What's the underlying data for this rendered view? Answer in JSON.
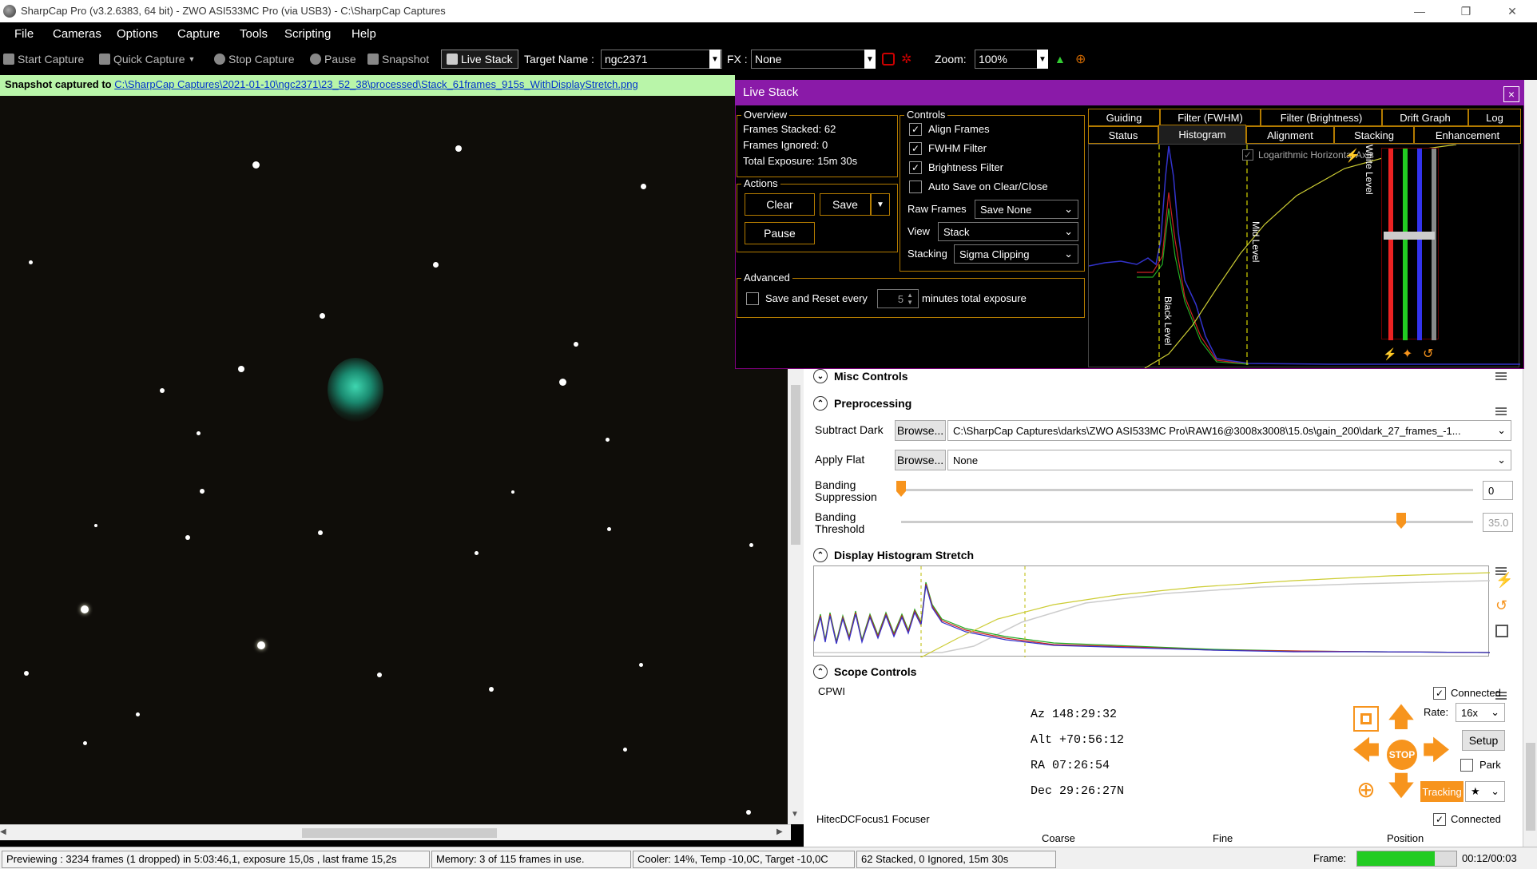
{
  "window": {
    "title": "SharpCap Pro (v3.2.6383, 64 bit) - ZWO ASI533MC Pro (via USB3) - C:\\SharpCap Captures",
    "minimize": "—",
    "maximize": "❐",
    "close": "✕"
  },
  "menu": [
    "File",
    "Cameras",
    "Options",
    "Capture",
    "Tools",
    "Scripting",
    "Help"
  ],
  "toolbar": {
    "start_capture": "Start Capture",
    "quick_capture": "Quick Capture",
    "stop_capture": "Stop Capture",
    "pause": "Pause",
    "snapshot": "Snapshot",
    "live_stack": "Live Stack",
    "target_name_label": "Target Name :",
    "target_name_value": "ngc2371",
    "fx_label": "FX :",
    "fx_value": "None",
    "zoom_label": "Zoom:",
    "zoom_value": "100%"
  },
  "snapshot_bar": {
    "prefix": "Snapshot captured to",
    "path": "C:\\SharpCap Captures\\2021-01-10\\ngc2371\\23_52_38\\processed\\Stack_61frames_915s_WithDisplayStretch.png"
  },
  "live_stack": {
    "title": "Live Stack",
    "close": "×",
    "overview": {
      "title": "Overview",
      "frames_stacked": "Frames Stacked:  62",
      "frames_ignored": "Frames Ignored:   0",
      "total_exposure": "Total Exposure:   15m 30s"
    },
    "actions": {
      "title": "Actions",
      "clear": "Clear",
      "save": "Save",
      "pause": "Pause"
    },
    "advanced": {
      "title": "Advanced",
      "save_reset_label": "Save and Reset every",
      "save_reset_value": "5",
      "save_reset_suffix": "minutes total exposure"
    },
    "controls": {
      "title": "Controls",
      "align_frames": "Align Frames",
      "fwhm_filter": "FWHM Filter",
      "brightness_filter": "Brightness Filter",
      "auto_save": "Auto Save on Clear/Close",
      "raw_frames_label": "Raw Frames",
      "raw_frames_value": "Save None",
      "view_label": "View",
      "view_value": "Stack",
      "stacking_label": "Stacking",
      "stacking_value": "Sigma Clipping"
    },
    "tabs_row1": [
      "Guiding",
      "Filter (FWHM)",
      "Filter (Brightness)",
      "Drift Graph",
      "Log"
    ],
    "tabs_row2": [
      "Status",
      "Histogram",
      "Alignment",
      "Stacking",
      "Enhancement"
    ],
    "histogram": {
      "log_axis": "Logarithmic Horizontal Axis",
      "black_level": "Black Level",
      "mid_level": "Mid Level",
      "white_level": "White Level"
    }
  },
  "panels": {
    "misc_controls": "Misc Controls",
    "preprocessing": {
      "title": "Preprocessing",
      "subtract_dark_label": "Subtract Dark",
      "browse": "Browse...",
      "subtract_dark_value": "C:\\SharpCap Captures\\darks\\ZWO ASI533MC Pro\\RAW16@3008x3008\\15.0s\\gain_200\\dark_27_frames_-1...",
      "apply_flat_label": "Apply Flat",
      "apply_flat_value": "None",
      "banding_suppression_label": "Banding Suppression",
      "banding_suppression_value": "0",
      "banding_threshold_label": "Banding Threshold",
      "banding_threshold_value": "35.0"
    },
    "display_histogram": "Display Histogram Stretch",
    "scope_controls": {
      "title": "Scope Controls",
      "mount": "CPWI",
      "connected": "Connected",
      "az": "Az  148:29:32",
      "alt": "Alt +70:56:12",
      "ra": "RA  07:26:54",
      "dec": "Dec 29:26:27N",
      "rate_label": "Rate:",
      "rate_value": "16x",
      "setup": "Setup",
      "park": "Park",
      "tracking": "Tracking",
      "stop": "STOP"
    },
    "focuser": {
      "title": "HitecDCFocus1 Focuser",
      "connected": "Connected",
      "coarse": "Coarse",
      "fine": "Fine",
      "position": "Position"
    }
  },
  "status_bar": {
    "preview": "Previewing : 3234 frames (1 dropped) in 5:03:46,1, exposure 15,0s , last frame 15,2s",
    "memory": "Memory: 3 of 115 frames in use.",
    "cooler": "Cooler: 14%, Temp -10,0C, Target -10,0C",
    "stacked": "62 Stacked, 0 Ignored, 15m 30s",
    "frame_label": "Frame:",
    "frame_time": "00:12/00:03"
  },
  "colors": {
    "accent": "#8a1aa8",
    "orange": "#f7941d",
    "snapbar": "#b9f5a9"
  }
}
